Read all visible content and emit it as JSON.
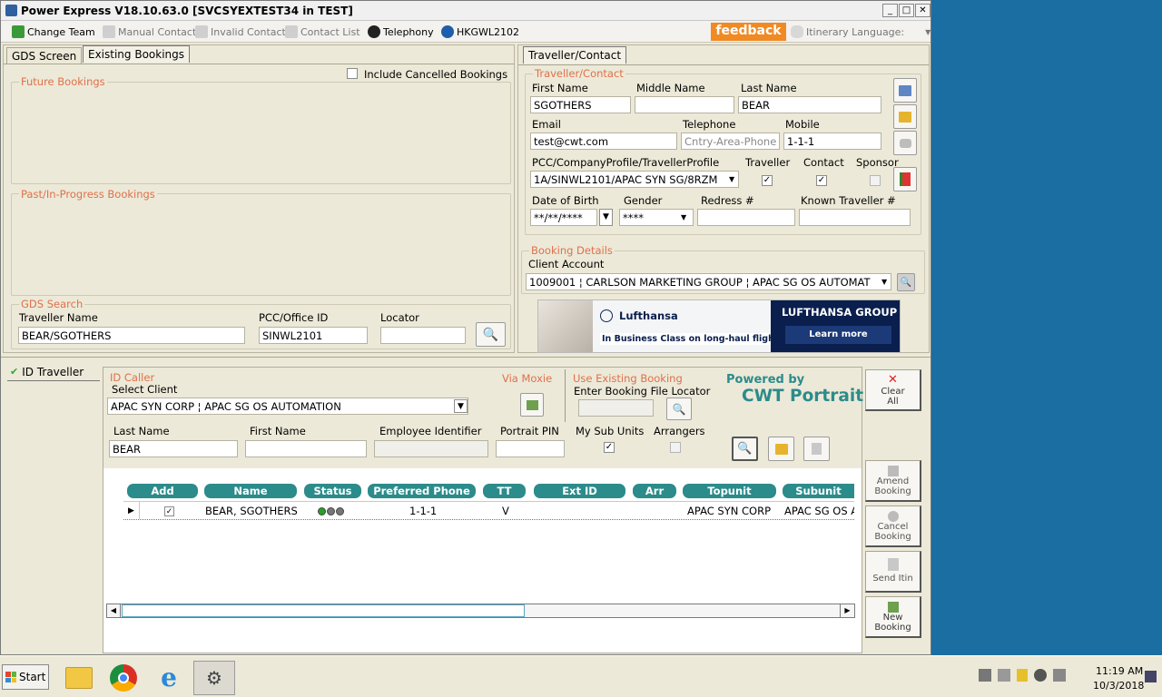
{
  "window": {
    "title": "Power Express V18.10.63.0  [SVCSYEXTEST34 in TEST]"
  },
  "toolbar": {
    "change_team": "Change Team",
    "manual_contact": "Manual Contact",
    "invalid_contact": "Invalid Contact",
    "contact_list": "Contact List",
    "telephony": "Telephony",
    "pcc": "HKGWL2102",
    "feedback": "feedback",
    "itinerary_language": "Itinerary Language:"
  },
  "left_tabs": {
    "gds_screen": "GDS Screen",
    "existing_bookings": "Existing Bookings"
  },
  "include_cancelled": "Include Cancelled Bookings",
  "future_bookings": "Future Bookings",
  "past_bookings": "Past/In-Progress Bookings",
  "gds_search": {
    "title": "GDS Search",
    "traveller_name_label": "Traveller Name",
    "traveller_name": "BEAR/SGOTHERS",
    "pcc_label": "PCC/Office ID",
    "pcc": "SINWL2101",
    "locator_label": "Locator",
    "locator": ""
  },
  "right_tab": "Traveller/Contact",
  "traveller": {
    "group": "Traveller/Contact",
    "first_name_label": "First Name",
    "first_name": "SGOTHERS",
    "middle_name_label": "Middle Name",
    "middle_name": "",
    "last_name_label": "Last Name",
    "last_name": "BEAR",
    "email_label": "Email",
    "email": "test@cwt.com",
    "telephone_label": "Telephone",
    "telephone_placeholder": "Cntry-Area-Phone",
    "mobile_label": "Mobile",
    "mobile": "1-1-1",
    "profile_label": "PCC/CompanyProfile/TravellerProfile",
    "profile": "1A/SINWL2101/APAC SYN SG/8RZM",
    "traveller_cb": "Traveller",
    "contact_cb": "Contact",
    "sponsor_cb": "Sponsor",
    "dob_label": "Date of Birth",
    "dob": "**/**/****",
    "gender_label": "Gender",
    "gender": "****",
    "redress_label": "Redress #",
    "redress": "",
    "ktn_label": "Known Traveller #",
    "ktn": ""
  },
  "booking_details": {
    "group": "Booking Details",
    "client_account_label": "Client Account",
    "client_account": "1009001 ¦ CARLSON MARKETING GROUP ¦ APAC SG OS AUTOMAT"
  },
  "ad": {
    "brand": "Lufthansa",
    "tagline": "In Business Class on long-haul flights",
    "group": "LUFTHANSA GROUP",
    "cta": "Learn more"
  },
  "id_traveller": {
    "tab": "ID Traveller",
    "id_caller": "ID Caller",
    "select_client_label": "Select Client",
    "select_client": "APAC SYN CORP ¦ APAC SG OS AUTOMATION",
    "via_moxie": "Via Moxie",
    "use_existing_booking": "Use Existing Booking",
    "booking_file_label": "Enter Booking File Locator",
    "powered_by": "Powered by",
    "portrait": "CWT Portrait",
    "last_name_label": "Last Name",
    "last_name": "BEAR",
    "first_name_label": "First Name",
    "first_name": "",
    "employee_id_label": "Employee Identifier",
    "employee_id": "",
    "portrait_pin_label": "Portrait PIN",
    "portrait_pin": "",
    "my_sub_units_label": "My Sub Units",
    "arrangers_label": "Arrangers"
  },
  "grid": {
    "columns": [
      "Add",
      "Name",
      "Status",
      "Preferred Phone",
      "TT",
      "Ext ID",
      "Arr",
      "Topunit",
      "Subunit"
    ],
    "row": {
      "name": "BEAR, SGOTHERS",
      "phone": "1-1-1",
      "tt": "V",
      "ext_id": "",
      "arr": "",
      "topunit": "APAC SYN CORP",
      "subunit": "APAC SG OS AUTOMATION"
    }
  },
  "side_buttons": {
    "clear": "Clear",
    "all": "All",
    "amend": "Amend",
    "cancel": "Cancel",
    "booking": "Booking",
    "send_itin": "Send Itin",
    "new": "New"
  },
  "taskbar": {
    "start": "Start",
    "time": "11:19 AM",
    "date": "10/3/2018"
  },
  "colors": {
    "accent_label": "#e0704a",
    "teal": "#2c8b8b",
    "feedback": "#f08a24",
    "desktop": "#1a6ea1"
  }
}
